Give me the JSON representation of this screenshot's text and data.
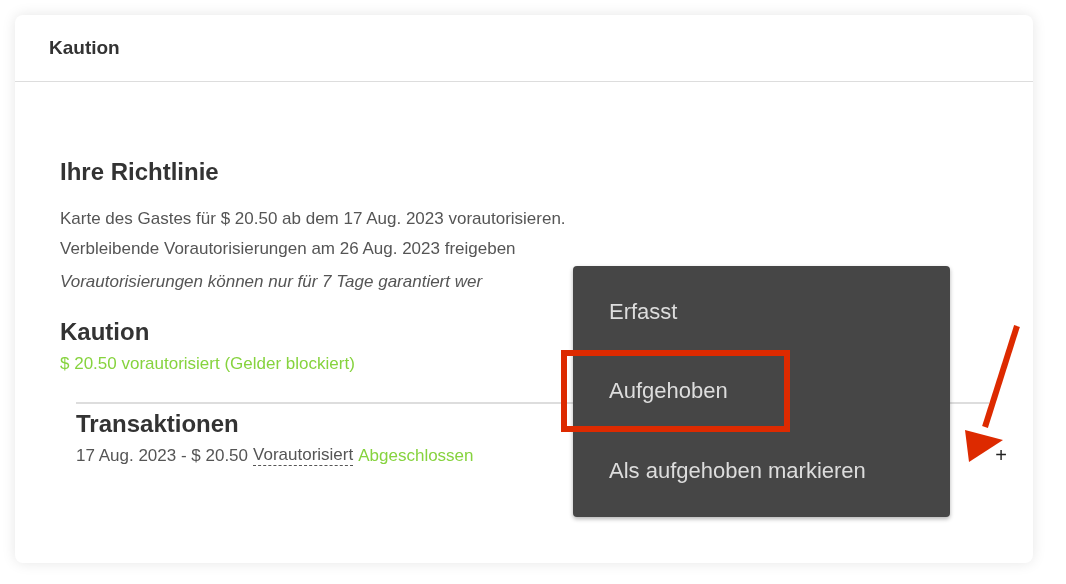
{
  "card": {
    "title": "Kaution"
  },
  "policy": {
    "heading": "Ihre Richtlinie",
    "lines": [
      "Karte des Gastes für $ 20.50 ab dem 17 Aug. 2023 vorautorisieren.",
      "Verbleibende Vorautorisierungen am 26 Aug. 2023 freigeben"
    ],
    "note": "Vorautorisierungen können nur für 7 Tage garantiert wer"
  },
  "deposit": {
    "heading": "Kaution",
    "status": "$ 20.50 vorautorisiert (Gelder blockiert)"
  },
  "transactions": {
    "heading": "Transaktionen",
    "rows": [
      {
        "summary": "17 Aug. 2023 - $ 20.50",
        "type": "Vorautorisiert",
        "state": "Abgeschlossen",
        "action": "+"
      }
    ]
  },
  "menu": {
    "items": [
      {
        "label": "Erfasst",
        "highlighted": false
      },
      {
        "label": "Aufgehoben",
        "highlighted": true
      },
      {
        "label": "Als aufgehoben markieren",
        "highlighted": false
      }
    ]
  },
  "annotation": {
    "arrow": true
  }
}
